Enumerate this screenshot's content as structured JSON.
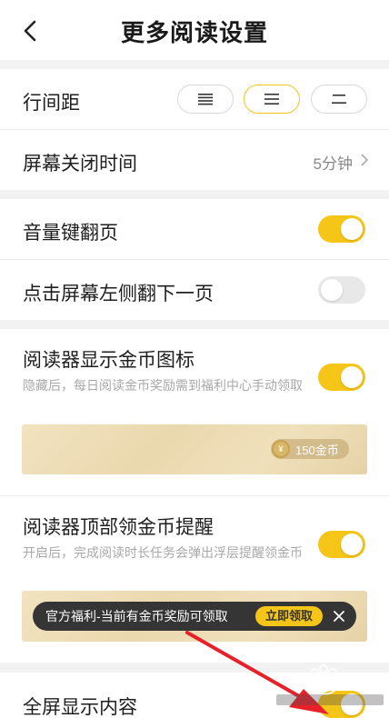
{
  "header": {
    "title": "更多阅读设置",
    "back_icon": "chevron-left-icon"
  },
  "line_spacing": {
    "label": "行间距",
    "options": [
      {
        "name": "wide",
        "icon": "four-lines-icon",
        "active": false
      },
      {
        "name": "medium",
        "icon": "three-lines-icon",
        "active": true
      },
      {
        "name": "narrow",
        "icon": "two-lines-icon",
        "active": false
      }
    ]
  },
  "screen_off": {
    "label": "屏幕关闭时间",
    "value": "5分钟"
  },
  "volume_key": {
    "label": "音量键翻页",
    "enabled": true
  },
  "tap_left": {
    "label": "点击屏幕左侧翻下一页",
    "enabled": false
  },
  "coin_icon": {
    "label": "阅读器显示金币图标",
    "desc": "隐藏后，每日阅读金币奖励需到福利中心手动领取",
    "enabled": true,
    "preview_coin": "150金币",
    "coin_symbol": "¥"
  },
  "top_reminder": {
    "label": "阅读器顶部领金币提醒",
    "desc": "开启后，完成阅读时长任务会弹出浮层提醒领金币",
    "enabled": true,
    "banner_text": "官方福利-当前有金币奖励可领取",
    "banner_button": "立即领取"
  },
  "fullscreen": {
    "label": "全屏显示内容",
    "enabled": true
  },
  "colors": {
    "accent": "#f5c518",
    "annotation_arrow": "#e8202a"
  }
}
